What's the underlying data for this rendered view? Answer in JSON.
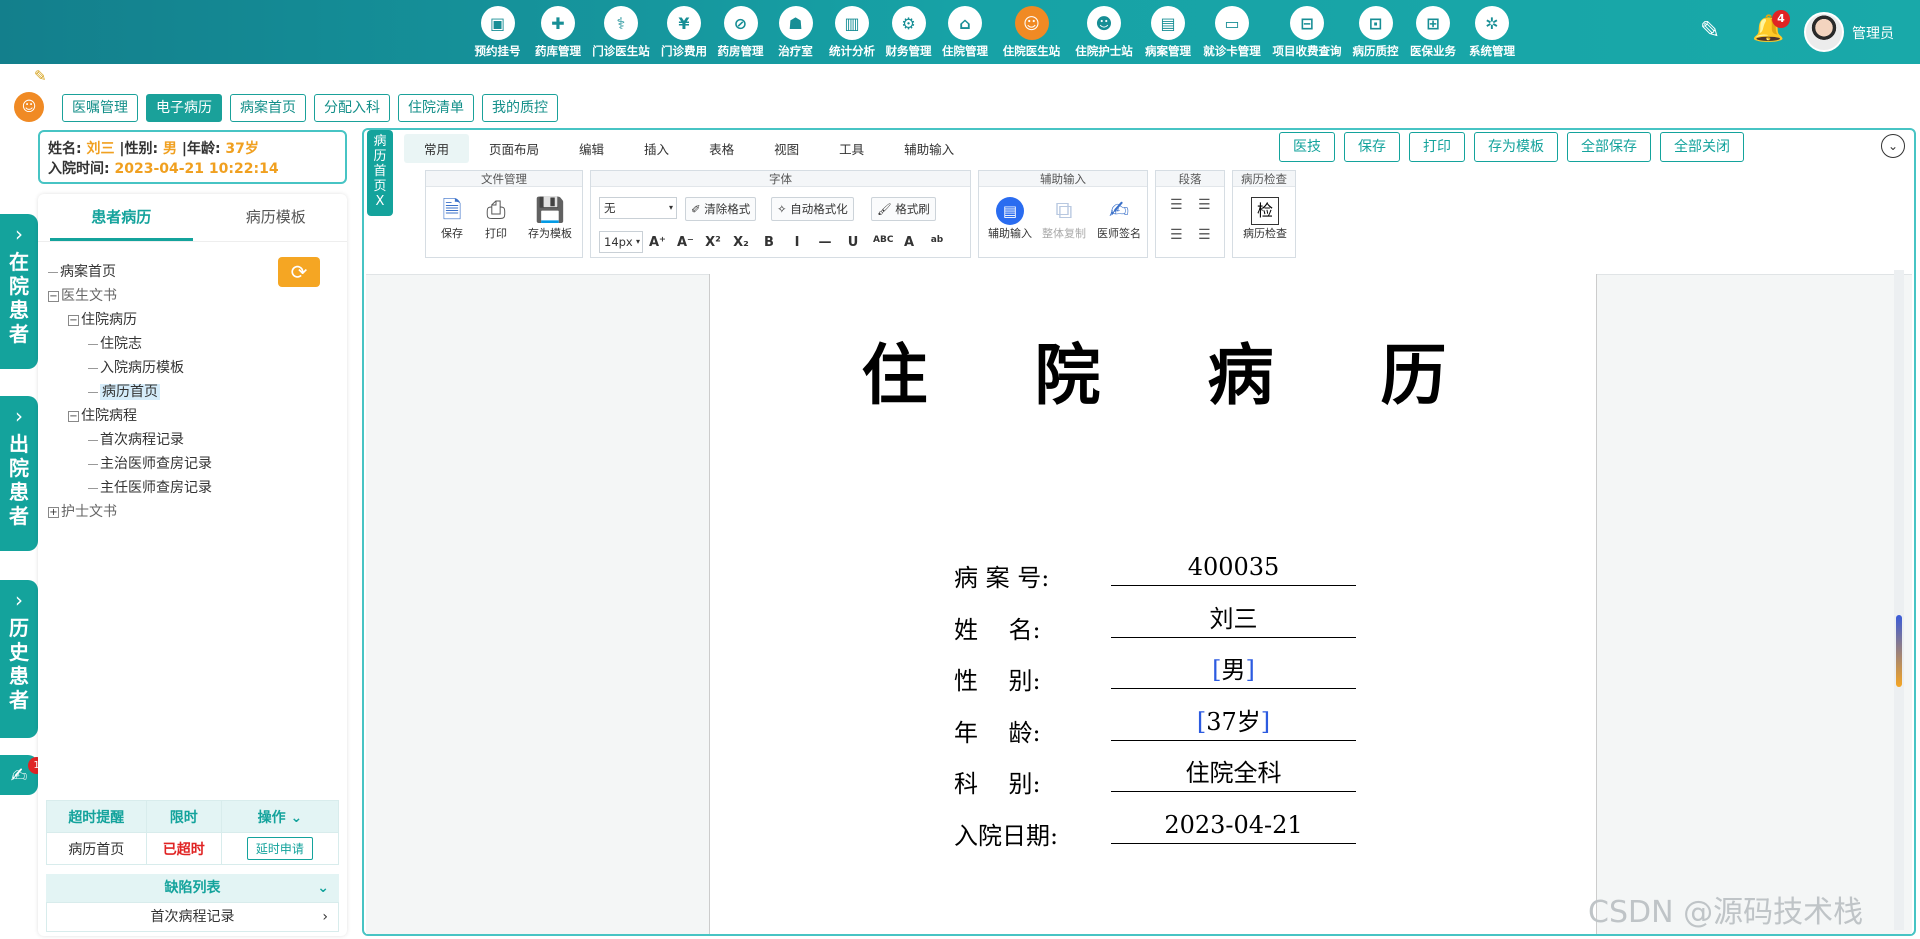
{
  "nav": {
    "items": [
      {
        "label": "预约挂号",
        "icon": "calendar-icon",
        "glyph": "▣",
        "active": false
      },
      {
        "label": "药库管理",
        "icon": "pill-box-icon",
        "glyph": "✚",
        "active": false
      },
      {
        "label": "门诊医生站",
        "icon": "doctor-icon",
        "glyph": "⚕",
        "active": false
      },
      {
        "label": "门诊费用",
        "icon": "yuan-icon",
        "glyph": "¥",
        "active": false
      },
      {
        "label": "药房管理",
        "icon": "capsule-icon",
        "glyph": "⊘",
        "active": false
      },
      {
        "label": "治疗室",
        "icon": "nurse-icon",
        "glyph": "☗",
        "active": false
      },
      {
        "label": "统计分析",
        "icon": "bar-chart-icon",
        "glyph": "▥",
        "active": false
      },
      {
        "label": "财务管理",
        "icon": "finance-gear-icon",
        "glyph": "⚙",
        "active": false
      },
      {
        "label": "住院管理",
        "icon": "bed-icon",
        "glyph": "⌂",
        "active": false
      },
      {
        "label": "住院医生站",
        "icon": "inpatient-doctor-icon",
        "glyph": "☺",
        "active": true
      },
      {
        "label": "住院护士站",
        "icon": "inpatient-nurse-icon",
        "glyph": "☻",
        "active": false
      },
      {
        "label": "病案管理",
        "icon": "medical-record-icon",
        "glyph": "▤",
        "active": false
      },
      {
        "label": "就诊卡管理",
        "icon": "card-icon",
        "glyph": "▭",
        "active": false
      },
      {
        "label": "项目收费查询",
        "icon": "fee-query-icon",
        "glyph": "⊟",
        "active": false
      },
      {
        "label": "病历质控",
        "icon": "quality-control-icon",
        "glyph": "⊡",
        "active": false
      },
      {
        "label": "医保业务",
        "icon": "insurance-icon",
        "glyph": "⊞",
        "active": false
      },
      {
        "label": "系统管理",
        "icon": "system-gear-icon",
        "glyph": "✲",
        "active": false
      }
    ],
    "notification_count": "4",
    "username": "管理员"
  },
  "subtabs": [
    {
      "label": "医嘱管理",
      "active": false
    },
    {
      "label": "电子病历",
      "active": true
    },
    {
      "label": "病案首页",
      "active": false
    },
    {
      "label": "分配入科",
      "active": false
    },
    {
      "label": "住院清单",
      "active": false
    },
    {
      "label": "我的质控",
      "active": false
    }
  ],
  "rails": [
    {
      "label": "在院患者"
    },
    {
      "label": "出院患者"
    },
    {
      "label": "历史患者"
    }
  ],
  "rail_note_badge": "1",
  "patient": {
    "name_label": "姓名:",
    "name": "刘三",
    "sex_label": "|性别:",
    "sex": "男",
    "age_label": "|年龄:",
    "age": "37岁",
    "admit_label": "入院时间:",
    "admit_time": "2023-04-21 10:22:14"
  },
  "panel": {
    "tabs": [
      "患者病历",
      "病历模板"
    ],
    "tree": [
      {
        "label": "病案首页",
        "level": 0,
        "toggle": "",
        "selected": false,
        "muted": false
      },
      {
        "label": "医生文书",
        "level": 0,
        "toggle": "−",
        "selected": false,
        "muted": true
      },
      {
        "label": "住院病历",
        "level": 1,
        "toggle": "−",
        "selected": false,
        "muted": false
      },
      {
        "label": "住院志",
        "level": 2,
        "toggle": "",
        "selected": false,
        "muted": false
      },
      {
        "label": "入院病历模板",
        "level": 2,
        "toggle": "",
        "selected": false,
        "muted": false
      },
      {
        "label": "病历首页",
        "level": 2,
        "toggle": "",
        "selected": true,
        "muted": false
      },
      {
        "label": "住院病程",
        "level": 1,
        "toggle": "−",
        "selected": false,
        "muted": false
      },
      {
        "label": "首次病程记录",
        "level": 2,
        "toggle": "",
        "selected": false,
        "muted": false
      },
      {
        "label": "主治医师查房记录",
        "level": 2,
        "toggle": "",
        "selected": false,
        "muted": false
      },
      {
        "label": "主任医师查房记录",
        "level": 2,
        "toggle": "",
        "selected": false,
        "muted": false
      },
      {
        "label": "护士文书",
        "level": 0,
        "toggle": "+",
        "selected": false,
        "muted": true
      }
    ],
    "overtime": {
      "headers": [
        "超时提醒",
        "限时",
        "操作"
      ],
      "row": {
        "name": "病历首页",
        "status": "已超时",
        "action": "延时申请"
      }
    },
    "defect_title": "缺陷列表",
    "defect_item": "首次病程记录"
  },
  "doc_tab_label": "病历首页X",
  "ribbon": {
    "tabs": [
      "常用",
      "页面布局",
      "编辑",
      "插入",
      "表格",
      "视图",
      "工具",
      "辅助输入"
    ],
    "top_actions": [
      "医技",
      "保存",
      "打印",
      "存为模板",
      "全部保存",
      "全部关闭"
    ],
    "groups": {
      "file": {
        "title": "文件管理",
        "buttons": [
          "保存",
          "打印",
          "存为模板"
        ]
      },
      "font": {
        "title": "字体",
        "font_name": "无",
        "font_size": "14px",
        "clear": "清除格式",
        "auto": "自动格式化",
        "brush": "格式刷",
        "icons": [
          "A⁺",
          "A⁻",
          "X²",
          "X₂",
          "B",
          "I",
          "—",
          "U",
          "ABC",
          "A",
          "ab"
        ]
      },
      "assist": {
        "title": "辅助输入",
        "buttons": [
          "辅助输入",
          "整体复制",
          "医师签名"
        ]
      },
      "para": {
        "title": "段落"
      },
      "check": {
        "title": "病历检查",
        "button": "病历检查",
        "glyph": "检"
      }
    }
  },
  "document": {
    "title": "住 院 病 历",
    "fields": [
      {
        "label": "病 案 号:",
        "value": "400035",
        "bracket": false
      },
      {
        "label": "姓    名:",
        "value": "刘三",
        "bracket": false
      },
      {
        "label": "性    别:",
        "value": "男",
        "bracket": true
      },
      {
        "label": "年    龄:",
        "value": "37岁",
        "bracket": true
      },
      {
        "label": "科    别:",
        "value": "住院全科",
        "bracket": false
      },
      {
        "label": "入院日期:",
        "value": "2023-04-21",
        "bracket": false
      }
    ]
  },
  "watermark": "CSDN @源码技术栈"
}
